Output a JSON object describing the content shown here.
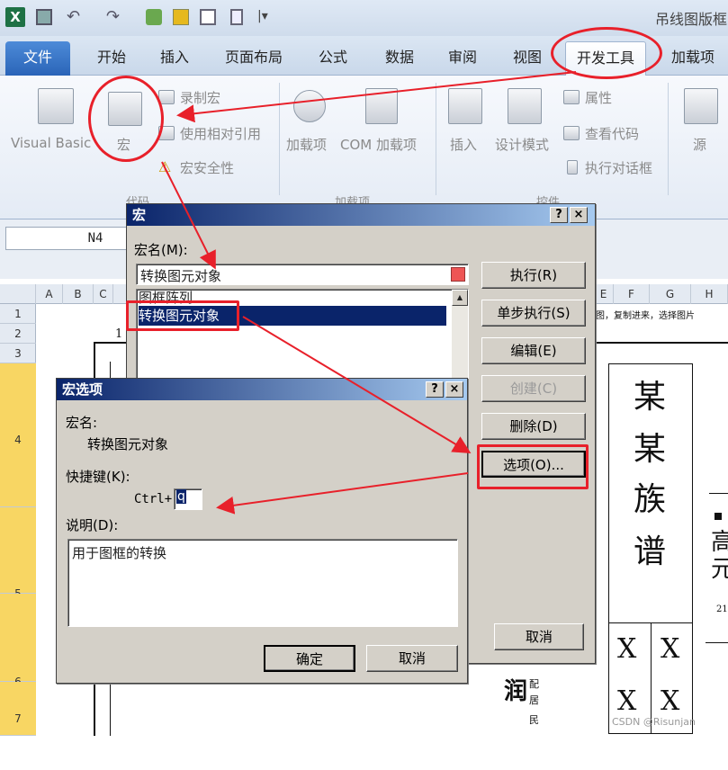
{
  "titlebar": {
    "app_icon": "excel-icon",
    "filename": "吊线图版框"
  },
  "tabs": [
    "文件",
    "开始",
    "插入",
    "页面布局",
    "公式",
    "数据",
    "审阅",
    "视图",
    "开发工具",
    "加载项"
  ],
  "ribbon": {
    "visual_basic": "Visual Basic",
    "macros": "宏",
    "record_macro": "录制宏",
    "relative_ref": "使用相对引用",
    "macro_security": "宏安全性",
    "addins": "加载项",
    "com_addins": "COM 加载项",
    "insert": "插入",
    "design_mode": "设计模式",
    "properties": "属性",
    "view_code": "查看代码",
    "run_dialog": "执行对话框",
    "source": "源",
    "group_code": "代码",
    "group_addins": "加载项",
    "group_controls": "控件"
  },
  "namebox": "N4",
  "columns": [
    "A",
    "B",
    "C",
    "E",
    "F",
    "G",
    "H"
  ],
  "rows": [
    "1",
    "2",
    "3",
    "4",
    "5",
    "6",
    "7"
  ],
  "sheet": {
    "title_chars": [
      "某",
      "某",
      "族",
      "谱"
    ],
    "x_marks": [
      "X",
      "X",
      "X",
      "X"
    ],
    "row1_text": "图，复制进来，选择图片",
    "small_num": "1",
    "right_chars": [
      "高",
      "元"
    ],
    "side_num": "21",
    "name_char": "润",
    "side_small": [
      "配",
      "居",
      "民"
    ]
  },
  "macro_dialog": {
    "title": "宏",
    "name_label": "宏名(M):",
    "name_value": "转换图元对象",
    "list": [
      "图框阵列",
      "转换图元对象"
    ],
    "buttons": {
      "run": "执行(R)",
      "step": "单步执行(S)",
      "edit": "编辑(E)",
      "create": "创建(C)",
      "delete": "删除(D)",
      "options": "选项(O)...",
      "cancel": "取消"
    },
    "help": "?",
    "close": "×"
  },
  "options_dialog": {
    "title": "宏选项",
    "name_label": "宏名:",
    "name_value": "转换图元对象",
    "shortcut_label": "快捷键(K):",
    "ctrl_prefix": "Ctrl+",
    "shortcut_value": "q",
    "desc_label": "说明(D):",
    "desc_value": "用于图框的转换",
    "ok": "确定",
    "cancel": "取消",
    "help": "?",
    "close": "×"
  },
  "watermark": "CSDN @Risunjan"
}
